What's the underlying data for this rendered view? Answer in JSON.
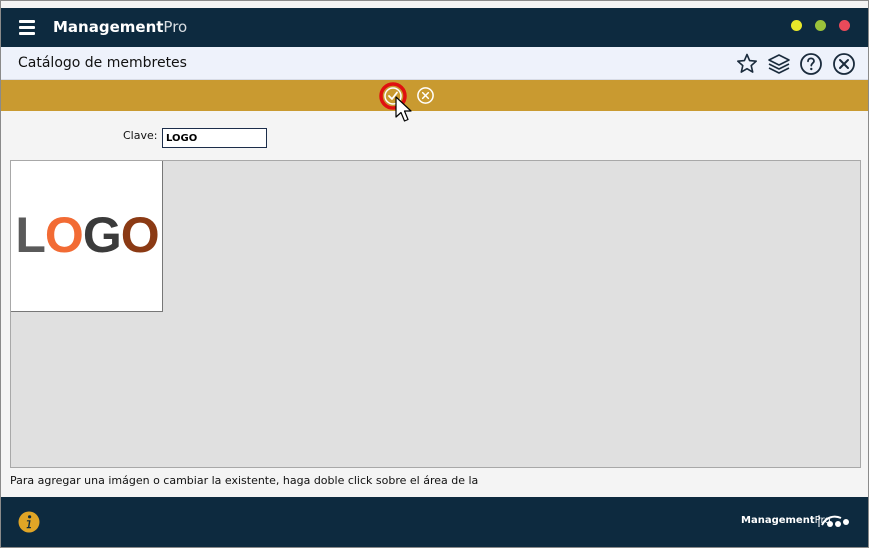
{
  "app": {
    "brand_bold": "Management",
    "brand_light": "Pro"
  },
  "header": {
    "title": "Catálogo de membretes",
    "icons": [
      "star-icon",
      "layers-icon",
      "help-icon",
      "close-circle-icon"
    ]
  },
  "actionbar": {
    "icons": [
      "check-circle-icon",
      "cancel-circle-icon"
    ]
  },
  "form": {
    "clave_label": "Clave:",
    "clave_value": "LOGO"
  },
  "image": {
    "logo_letters": [
      "L",
      "O",
      "G",
      "O"
    ]
  },
  "hint": {
    "line1": "Para agregar una imágen o cambiar la existente, haga doble click sobre el área de la"
  },
  "footer": {
    "brand_bold": "Management",
    "brand_light": "Pro"
  },
  "colors": {
    "titlebar": "#0d2a3f",
    "accent_bar": "#c99a30",
    "header_bg": "#eef2fb",
    "logo_orange": "#f26b34",
    "logo_brown": "#8b3a14"
  }
}
